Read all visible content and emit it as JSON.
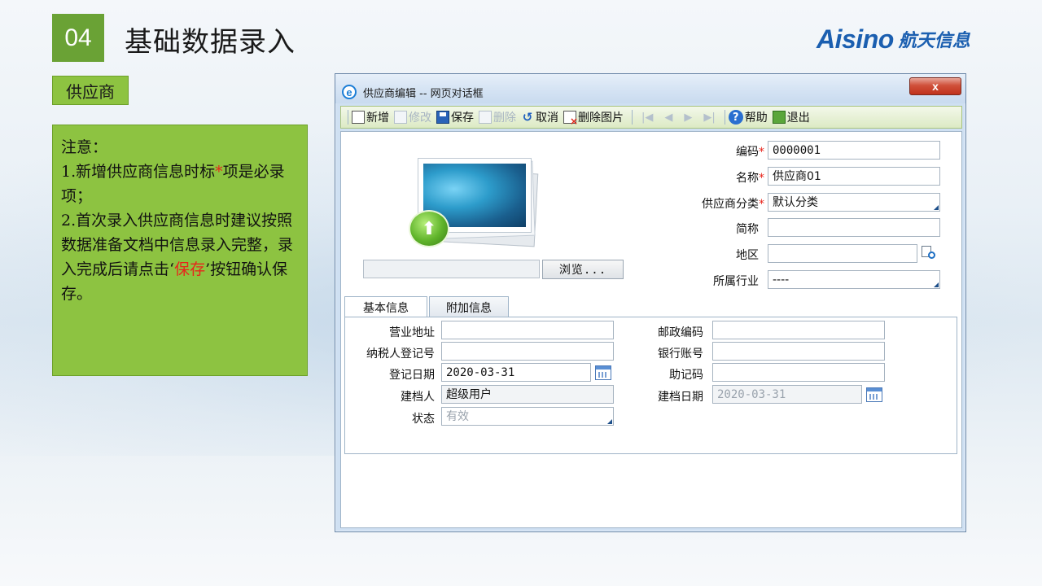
{
  "slide": {
    "number": "04",
    "title": "基础数据录入",
    "logo_latin": "Aisino",
    "logo_cn": "航天信息",
    "section": "供应商",
    "note": {
      "heading": "注意：",
      "line1_prefix": "1.新增供应商信息时标",
      "line1_star": "*",
      "line1_suffix": "项是必录项；",
      "line2": "2.首次录入供应商信息时建议按照数据准备文档中信息录入完整，录入完成后请点击",
      "line2_quote_open": "‘",
      "line2_highlight": "保存",
      "line2_quote_close": "’",
      "line2_end": "按钮确认保存。"
    }
  },
  "dialog": {
    "title": "供应商编辑 -- 网页对话框",
    "close_label": "x",
    "toolbar": {
      "new": "新增",
      "edit": "修改",
      "save": "保存",
      "delete": "删除",
      "cancel": "取消",
      "delete_image": "删除图片",
      "help": "帮助",
      "exit": "退出"
    },
    "browse_label": "浏览...",
    "fields": {
      "code_label": "编码",
      "code_value": "0000001",
      "name_label": "名称",
      "name_value": "供应商01",
      "category_label": "供应商分类",
      "category_value": "默认分类",
      "short_label": "简称",
      "short_value": "",
      "region_label": "地区",
      "region_value": "",
      "industry_label": "所属行业",
      "industry_value": "----",
      "required_mark": "*"
    },
    "tabs": [
      "基本信息",
      "附加信息"
    ],
    "basic": {
      "address_label": "营业地址",
      "address_value": "",
      "taxpayer_label": "纳税人登记号",
      "taxpayer_value": "",
      "reg_date_label": "登记日期",
      "reg_date_value": "2020-03-31",
      "creator_label": "建档人",
      "creator_value": "超级用户",
      "status_label": "状态",
      "status_value": "有效",
      "postcode_label": "邮政编码",
      "postcode_value": "",
      "bank_label": "银行账号",
      "bank_value": "",
      "mnemonic_label": "助记码",
      "mnemonic_value": "",
      "create_date_label": "建档日期",
      "create_date_value": "2020-03-31"
    }
  }
}
